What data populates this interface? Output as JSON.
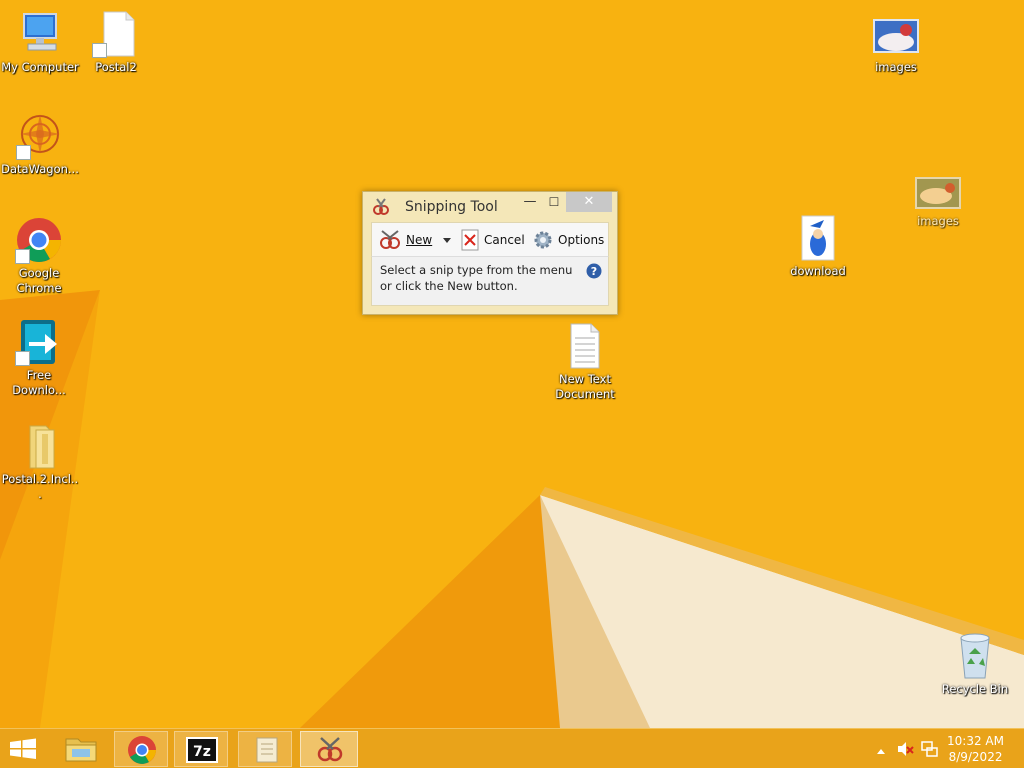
{
  "desktop": {
    "icons": [
      {
        "label": "My Computer"
      },
      {
        "label": "Postal2"
      },
      {
        "label": "DataWagon..."
      },
      {
        "label": "Google Chrome"
      },
      {
        "label": "Free Downlo..."
      },
      {
        "label": "Postal.2.Incl..."
      },
      {
        "label": "images"
      },
      {
        "label": "images"
      },
      {
        "label": "download"
      },
      {
        "label": "New Text Document"
      },
      {
        "label": "Recycle Bin"
      }
    ]
  },
  "snipping_tool": {
    "title": "Snipping Tool",
    "minimize": "—",
    "maximize": "☐",
    "close": "✕",
    "new_label": "New",
    "cancel_label": "Cancel",
    "options_label": "Options",
    "message_line1": "Select a snip type from the menu",
    "message_line2": "or click the New button."
  },
  "taskbar": {
    "apps": [
      "start-button",
      "file-explorer",
      "google-chrome",
      "7-zip",
      "notepad",
      "snipping-tool"
    ],
    "active_app": "snipping-tool",
    "time": "10:32 AM",
    "date": "8/9/2022"
  },
  "colors": {
    "desktop_bg": "#f8b210",
    "taskbar_bg": "#e9a31a"
  }
}
